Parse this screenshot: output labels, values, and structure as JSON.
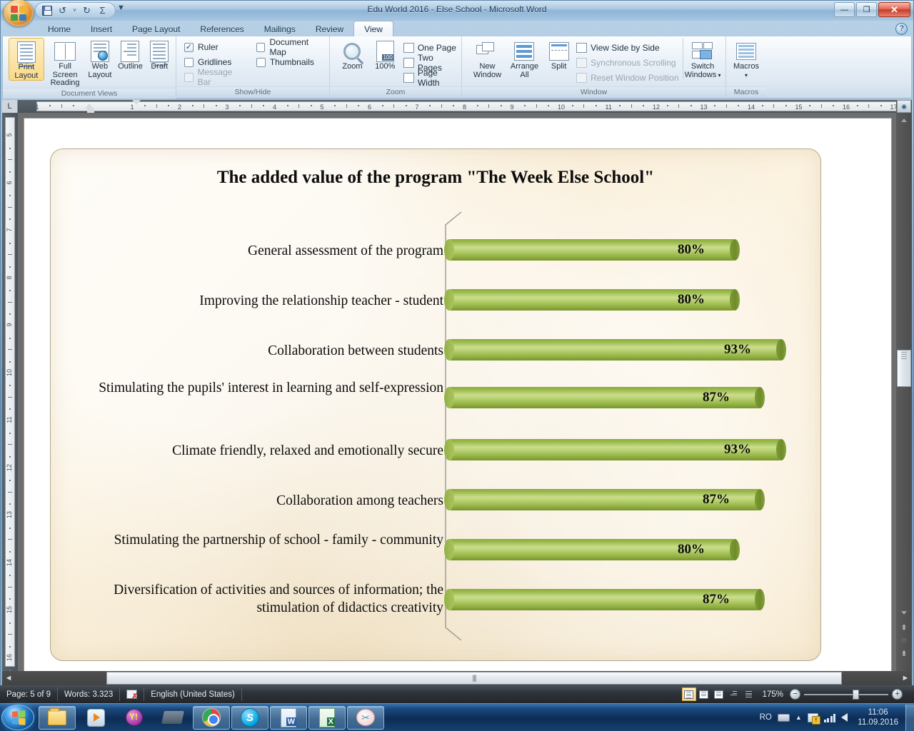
{
  "window": {
    "title": "Edu World 2016 - Else School - Microsoft Word",
    "minimize_label": "—",
    "restore_label": "❐",
    "close_label": "✕",
    "help_label": "?"
  },
  "quick_access": {
    "office_button": "office-orb",
    "items": [
      {
        "name": "save",
        "icon": "save-icon",
        "label": "Save"
      },
      {
        "name": "undo",
        "icon": "undo-icon",
        "label": "↺"
      },
      {
        "name": "undo-dropdown",
        "icon": "chevron-down-icon",
        "label": "˅"
      },
      {
        "name": "redo",
        "icon": "redo-icon",
        "label": "↻"
      },
      {
        "name": "autosum",
        "icon": "sigma-icon",
        "label": "Σ"
      }
    ],
    "customize_label": "▼"
  },
  "ribbon": {
    "tabs": [
      {
        "label": "Home",
        "active": false
      },
      {
        "label": "Insert",
        "active": false
      },
      {
        "label": "Page Layout",
        "active": false
      },
      {
        "label": "References",
        "active": false
      },
      {
        "label": "Mailings",
        "active": false
      },
      {
        "label": "Review",
        "active": false
      },
      {
        "label": "View",
        "active": true
      }
    ],
    "groups": [
      {
        "name": "document-views",
        "label": "Document Views",
        "buttons": [
          {
            "label": "Print\nLayout",
            "line1": "Print",
            "line2": "Layout",
            "selected": true
          },
          {
            "label": "Full Screen Reading",
            "line1": "Full Screen",
            "line2": "Reading",
            "selected": false
          },
          {
            "label": "Web Layout",
            "line1": "Web",
            "line2": "Layout",
            "selected": false
          },
          {
            "label": "Outline",
            "line1": "Outline",
            "line2": "",
            "selected": false
          },
          {
            "label": "Draft",
            "line1": "Draft",
            "line2": "",
            "selected": false
          }
        ]
      },
      {
        "name": "show-hide",
        "label": "Show/Hide",
        "checkboxes_left": [
          {
            "label": "Ruler",
            "checked": true,
            "disabled": false
          },
          {
            "label": "Gridlines",
            "checked": false,
            "disabled": false
          },
          {
            "label": "Message Bar",
            "checked": false,
            "disabled": true
          }
        ],
        "checkboxes_right": [
          {
            "label": "Document Map",
            "checked": false,
            "disabled": false
          },
          {
            "label": "Thumbnails",
            "checked": false,
            "disabled": false
          }
        ]
      },
      {
        "name": "zoom",
        "label": "Zoom",
        "buttons": [
          {
            "label": "Zoom"
          },
          {
            "label": "100%"
          }
        ],
        "items": [
          {
            "label": "One Page"
          },
          {
            "label": "Two Pages"
          },
          {
            "label": "Page Width"
          }
        ]
      },
      {
        "name": "window",
        "label": "Window",
        "buttons": [
          {
            "line1": "New",
            "line2": "Window"
          },
          {
            "line1": "Arrange",
            "line2": "All"
          },
          {
            "line1": "Split",
            "line2": ""
          }
        ],
        "items": [
          {
            "label": "View Side by Side",
            "disabled": false
          },
          {
            "label": "Synchronous Scrolling",
            "disabled": true
          },
          {
            "label": "Reset Window Position",
            "disabled": true
          }
        ],
        "switch_windows": {
          "line1": "Switch",
          "line2": "Windows"
        }
      },
      {
        "name": "macros",
        "label": "Macros",
        "button": {
          "line1": "Macros",
          "line2": "▾"
        }
      }
    ]
  },
  "ruler": {
    "tab_stop_label": "L",
    "horizontal_ticks": [
      "1",
      "1",
      "2",
      "3",
      "4",
      "5",
      "6",
      "7",
      "8",
      "9",
      "10",
      "11",
      "12",
      "13",
      "14",
      "15",
      "16"
    ],
    "vertical_ticks": [
      "5",
      "6",
      "7",
      "8",
      "9",
      "10",
      "11",
      "12",
      "13",
      "14",
      "15",
      "16"
    ]
  },
  "chart_data": {
    "type": "bar",
    "orientation": "horizontal",
    "title": "The added value of the program \"The Week Else School\"",
    "xlabel": "",
    "ylabel": "",
    "xlim": [
      0,
      100
    ],
    "grid": false,
    "legend": "none",
    "value_suffix": "%",
    "categories": [
      "General assessment of the program",
      "Improving the relationship teacher - student",
      "Collaboration between students",
      "Stimulating the pupils' interest in learning and self-expression",
      "Climate friendly, relaxed and emotionally secure",
      "Collaboration among teachers",
      "Stimulating the partnership of school - family - community",
      "Diversification of activities and sources of information; the stimulation of didactics creativity"
    ],
    "values": [
      80,
      80,
      93,
      87,
      93,
      87,
      80,
      87
    ],
    "data_labels": [
      "80%",
      "80%",
      "93%",
      "87%",
      "93%",
      "87%",
      "80%",
      "87%"
    ],
    "series_color": "#9CBB4D",
    "background_color": "#FBF0D9"
  },
  "status_bar": {
    "page": "Page: 5 of 9",
    "words": "Words: 3.323",
    "proofing_icon": "spelling-check-icon",
    "language": "English (United States)",
    "view_buttons": [
      {
        "name": "print-layout",
        "selected": true
      },
      {
        "name": "full-screen-reading",
        "selected": false
      },
      {
        "name": "web-layout",
        "selected": false
      },
      {
        "name": "outline",
        "selected": false
      },
      {
        "name": "draft",
        "selected": false
      }
    ],
    "zoom_level": "175%",
    "zoom_out_label": "−",
    "zoom_in_label": "+"
  },
  "taskbar": {
    "start_label": "Start",
    "items": [
      {
        "name": "windows-explorer",
        "icon": "folder-icon",
        "open": true
      },
      {
        "name": "windows-media-player",
        "icon": "media-player-icon",
        "open": false
      },
      {
        "name": "yahoo-messenger",
        "icon": "yahoo-icon",
        "open": false
      },
      {
        "name": "scanner",
        "icon": "scanner-icon",
        "open": false
      },
      {
        "name": "google-chrome",
        "icon": "chrome-icon",
        "open": true
      },
      {
        "name": "skype",
        "icon": "skype-icon",
        "open": true
      },
      {
        "name": "microsoft-word",
        "icon": "word-icon",
        "open": true
      },
      {
        "name": "microsoft-excel",
        "icon": "excel-icon",
        "open": true
      },
      {
        "name": "snipping-tool",
        "icon": "snip-icon",
        "open": true
      }
    ],
    "tray": {
      "language": "RO",
      "keyboard_icon": "keyboard-icon",
      "show_hidden_label": "▲",
      "network_icon": "network-warning-icon",
      "signal_icon": "signal-icon",
      "volume_icon": "volume-icon",
      "time": "11:06",
      "date": "11.09.2016"
    }
  }
}
